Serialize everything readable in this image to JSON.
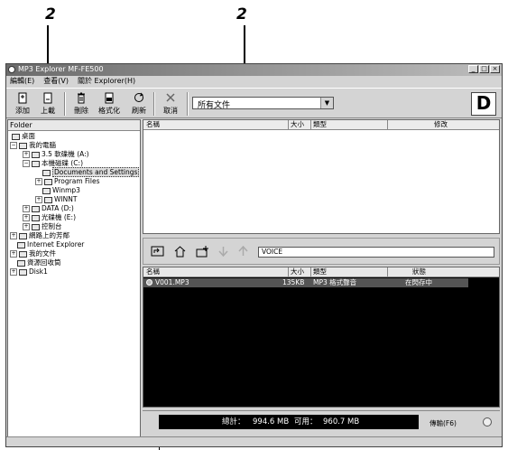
{
  "callouts": [
    "2",
    "2"
  ],
  "window": {
    "title": "MP3 Explorer MF-FE500",
    "controls": [
      "_",
      "□",
      "×"
    ]
  },
  "menu": [
    "編輯(E)",
    "查看(V)",
    "關於 Explorer(H)"
  ],
  "toolbar": {
    "add": "添加",
    "upload": "上載",
    "delete": "刪除",
    "format": "格式化",
    "refresh": "刷新",
    "cancel": "取消",
    "filter_value": "所有文件",
    "logo": "D"
  },
  "folder_pane": {
    "header": "Folder",
    "items": [
      {
        "label": "桌面",
        "expander": ""
      },
      {
        "label": "我的電腦",
        "expander": "−"
      },
      {
        "label": "3.5 軟碟機 (A:)",
        "expander": "+"
      },
      {
        "label": "本機磁碟 (C:)",
        "expander": "−"
      },
      {
        "label": "Documents and Settings",
        "expander": ""
      },
      {
        "label": "Program Files",
        "expander": "+"
      },
      {
        "label": "Winmp3",
        "expander": ""
      },
      {
        "label": "WINNT",
        "expander": "+"
      },
      {
        "label": "DATA (D:)",
        "expander": "+"
      },
      {
        "label": "光碟機 (E:)",
        "expander": "+"
      },
      {
        "label": "控制台",
        "expander": "+"
      },
      {
        "label": "網路上的芳鄰",
        "expander": "+"
      },
      {
        "label": "Internet Explorer",
        "expander": ""
      },
      {
        "label": "我的文件",
        "expander": "+"
      },
      {
        "label": "資源回收筒",
        "expander": ""
      },
      {
        "label": "Disk1",
        "expander": "+"
      }
    ]
  },
  "top_pane": {
    "columns": [
      "名稱",
      "大小",
      "類型",
      "修改"
    ]
  },
  "device_pane": {
    "path": "VOICE",
    "columns": [
      "名稱",
      "大小",
      "類型",
      "狀態"
    ],
    "rows": [
      {
        "name": "V001.MP3",
        "size": "135KB",
        "type": "MP3 格式聲音",
        "status": "在閃存中"
      }
    ]
  },
  "status": {
    "total_label": "總計：",
    "total_value": "994.6 MB",
    "free_label": "可用：",
    "free_value": "960.7 MB",
    "transfer_label": "傳輸(F6)"
  }
}
